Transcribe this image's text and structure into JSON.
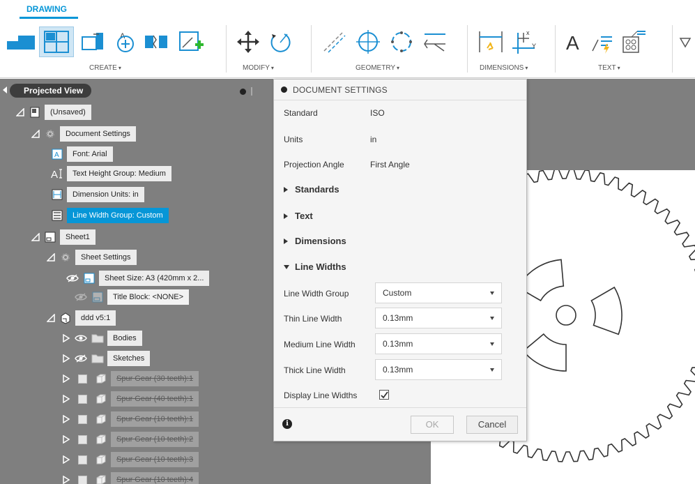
{
  "toolbar": {
    "workspace_tab": "DRAWING",
    "groups": [
      {
        "label": "CREATE"
      },
      {
        "label": "MODIFY"
      },
      {
        "label": "GEOMETRY"
      },
      {
        "label": "DIMENSIONS"
      },
      {
        "label": "TEXT"
      }
    ],
    "caret": "▾",
    "text_tool_glyph": "A"
  },
  "browser": {
    "title": "Projected View",
    "nodes": [
      {
        "label": "(Unsaved)",
        "icon": "drawing-icon"
      },
      {
        "label": "Document Settings",
        "icon": "gear-icon"
      },
      {
        "label": "Font: Arial",
        "icon": "font-icon"
      },
      {
        "label": "Text Height Group: Medium",
        "icon": "text-height-icon",
        "glyph": "AI"
      },
      {
        "label": "Dimension Units: in",
        "icon": "dimension-units-icon"
      },
      {
        "label": "Line Width Group: Custom",
        "icon": "line-width-icon",
        "selected": true
      },
      {
        "label": "Sheet1",
        "icon": "sheet-icon"
      },
      {
        "label": "Sheet Settings",
        "icon": "gear-icon"
      },
      {
        "label": "Sheet Size: A3 (420mm x 2...",
        "icon": "sheet-size-icon"
      },
      {
        "label": "Title Block: <NONE>",
        "icon": "title-block-icon"
      },
      {
        "label": "ddd v5:1",
        "icon": "component-icon"
      },
      {
        "label": "Bodies",
        "icon": "folder-icon"
      },
      {
        "label": "Sketches",
        "icon": "folder-icon"
      },
      {
        "label": "Spur Gear (30 teeth):1",
        "icon": "body-icon"
      },
      {
        "label": "Spur Gear (40 teeth):1",
        "icon": "body-icon"
      },
      {
        "label": "Spur Gear (10 teeth):1",
        "icon": "body-icon"
      },
      {
        "label": "Spur Gear (10 teeth):2",
        "icon": "body-icon"
      },
      {
        "label": "Spur Gear (10 teeth):3",
        "icon": "body-icon"
      },
      {
        "label": "Spur Gear (10 teeth):4",
        "icon": "body-icon"
      }
    ]
  },
  "dialog": {
    "title": "DOCUMENT SETTINGS",
    "props": [
      {
        "label": "Standard",
        "value": "ISO"
      },
      {
        "label": "Units",
        "value": "in"
      },
      {
        "label": "Projection Angle",
        "value": "First Angle"
      }
    ],
    "sections": {
      "standards": "Standards",
      "text": "Text",
      "dimensions": "Dimensions",
      "line_widths": "Line Widths"
    },
    "line_widths": {
      "group_label": "Line Width Group",
      "group_value": "Custom",
      "thin_label": "Thin Line Width",
      "thin_value": "0.13mm",
      "medium_label": "Medium Line Width",
      "medium_value": "0.13mm",
      "thick_label": "Thick Line Width",
      "thick_value": "0.13mm",
      "display_label": "Display Line Widths",
      "display_checked": true
    },
    "ok_label": "OK",
    "cancel_label": "Cancel",
    "info_glyph": "i"
  },
  "colors": {
    "accent": "#0696d7",
    "panel_bg": "#7f7f7f",
    "dialog_bg": "#f5f5f5"
  }
}
